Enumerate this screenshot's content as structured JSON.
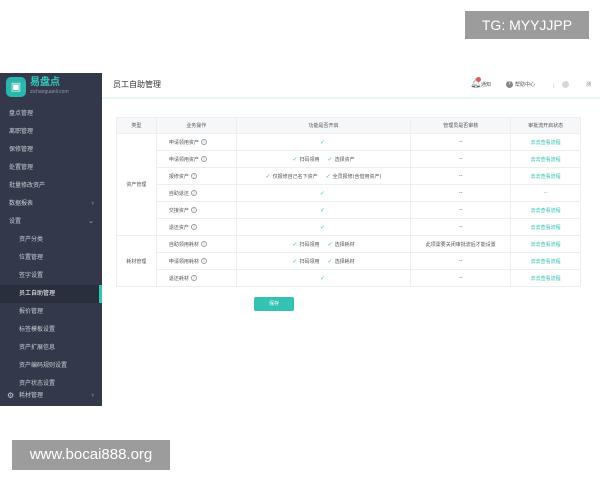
{
  "watermarks": {
    "top": "TG: MYYJJPP",
    "bottom": "www.bocai888.org"
  },
  "sidebar": {
    "logo_text": "易盘点",
    "logo_sub": "zichanguanli.com",
    "items": [
      {
        "label": "盘点管理",
        "sub": false,
        "active": false
      },
      {
        "label": "离职管理",
        "sub": false,
        "active": false
      },
      {
        "label": "保修管理",
        "sub": false,
        "active": false
      },
      {
        "label": "处置管理",
        "sub": false,
        "active": false
      },
      {
        "label": "批量修改资产",
        "sub": false,
        "active": false
      },
      {
        "label": "数据报表",
        "sub": false,
        "active": false,
        "arrow": "›"
      },
      {
        "label": "设置",
        "sub": false,
        "active": false,
        "arrow": "⌄"
      },
      {
        "label": "资产分类",
        "sub": true,
        "active": false
      },
      {
        "label": "位置管理",
        "sub": true,
        "active": false
      },
      {
        "label": "签字设置",
        "sub": true,
        "active": false
      },
      {
        "label": "员工自助管理",
        "sub": true,
        "active": true
      },
      {
        "label": "报价管理",
        "sub": true,
        "active": false
      },
      {
        "label": "标签模板设置",
        "sub": true,
        "active": false
      },
      {
        "label": "资产扩展信息",
        "sub": true,
        "active": false
      },
      {
        "label": "资产编码规则设置",
        "sub": true,
        "active": false
      },
      {
        "label": "资产状态设置",
        "sub": true,
        "active": false
      }
    ],
    "bottom_item": {
      "label": "耗材管理",
      "arrow": "›"
    }
  },
  "header": {
    "title": "员工自助管理",
    "notice": "通知",
    "help": "帮助中心",
    "user": "测"
  },
  "table": {
    "headers": [
      "类型",
      "业务操作",
      "功能是否开启",
      "管理员是否审核",
      "审批流开启状态"
    ],
    "groups": [
      {
        "type": "资产管理",
        "rows": [
          {
            "op": "申请领用资产",
            "func": [
              {
                "check": "✓",
                "text": ""
              }
            ],
            "review": "--",
            "status": "去去查看流程",
            "status_link": true
          },
          {
            "op": "申请领用资产",
            "func": [
              {
                "check": "✓",
                "text": "扫码领用"
              },
              {
                "check": "✓",
                "text": "选择资产"
              }
            ],
            "review": "--",
            "status": "去去查看流程",
            "status_link": true
          },
          {
            "op": "报修资产",
            "func": [
              {
                "check": "✓",
                "text": "仅报修自己名下资产"
              },
              {
                "check": "✓",
                "text": "全员报修(含借用资产)"
              }
            ],
            "review": "--",
            "status": "去去查看流程",
            "status_link": true
          },
          {
            "op": "自助退还",
            "func": [
              {
                "check": "✓",
                "text": ""
              }
            ],
            "review": "--",
            "status": "--",
            "status_link": false
          },
          {
            "op": "交接资产",
            "func": [
              {
                "check": "✓",
                "text": ""
              }
            ],
            "review": "--",
            "status": "去去查看流程",
            "status_link": true
          },
          {
            "op": "退还资产",
            "func": [
              {
                "check": "✓",
                "text": ""
              }
            ],
            "review": "--",
            "status": "去去查看流程",
            "status_link": true
          }
        ]
      },
      {
        "type": "耗材管理",
        "rows": [
          {
            "op": "自助领用耗材",
            "func": [
              {
                "check": "✓",
                "text": "扫码领用"
              },
              {
                "check": "✓",
                "text": "选择耗材"
              }
            ],
            "review": "此项需要关闭审批流后才能设置",
            "status": "去去查看流程",
            "status_link": true
          },
          {
            "op": "申请领用耗材",
            "func": [
              {
                "check": "✓",
                "text": "扫码领用"
              },
              {
                "check": "✓",
                "text": "选择耗材"
              }
            ],
            "review": "--",
            "status": "去去查看流程",
            "status_link": true
          },
          {
            "op": "退还耗材",
            "func": [
              {
                "check": "✓",
                "text": ""
              }
            ],
            "review": "--",
            "status": "去去查看流程",
            "status_link": true
          }
        ]
      }
    ]
  },
  "actions": {
    "save_label": "保存"
  },
  "colors": {
    "sidebar_bg": "#33394a",
    "accent": "#33c2b3"
  }
}
